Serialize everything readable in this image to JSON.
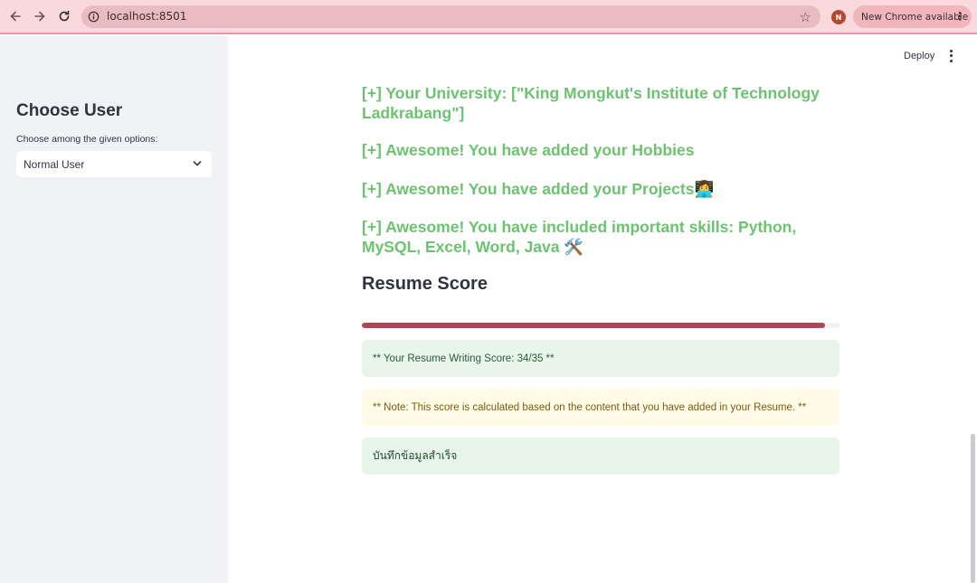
{
  "browser": {
    "url": "localhost:8501",
    "profile_initial": "N",
    "update_label": "New Chrome available"
  },
  "sidebar": {
    "title": "Choose User",
    "select_label": "Choose among the given options:",
    "select_value": "Normal User"
  },
  "toolbar": {
    "deploy_label": "Deploy"
  },
  "messages": [
    {
      "text": "[+] Your University: [\"King Mongkut's Institute of Technology Ladkrabang\"]",
      "emoji": ""
    },
    {
      "text": "[+] Awesome! You have added your Hobbies",
      "emoji": ""
    },
    {
      "text": "[+] Awesome! You have added your Projects",
      "emoji": "👩‍💻"
    },
    {
      "text": "[+] Awesome! You have included important skills: Python, MySQL, Excel, Word, Java ",
      "emoji": "🛠️"
    }
  ],
  "score": {
    "heading": "Resume Score",
    "progress": 0.97,
    "score_text": "** Your Resume Writing Score: 34/35 **",
    "note_text": "** Note: This score is calculated based on the content that you have added in your Resume. **",
    "saved_text": "บันทึกข้อมูลสำเร็จ"
  },
  "colors": {
    "success_text": "#6cc36f",
    "progress_bar": "#b04757",
    "chrome_bg": "#f9d9dc"
  }
}
